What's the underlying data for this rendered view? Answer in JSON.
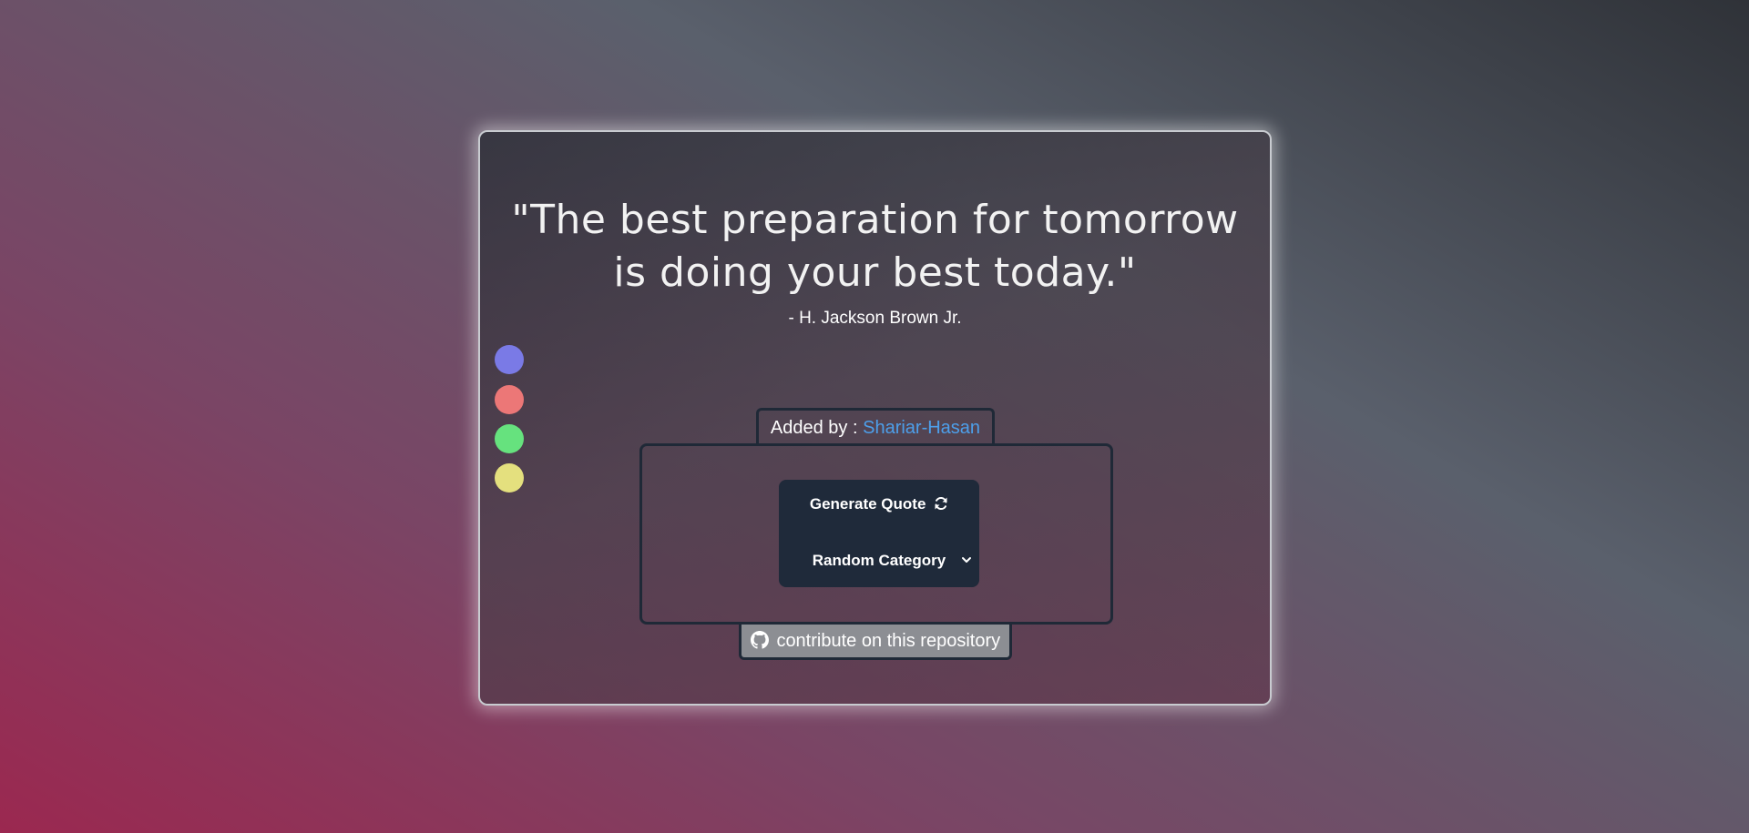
{
  "quote": {
    "text": "\"The best preparation for tomorrow is doing your best today.\"",
    "author": "- H. Jackson Brown Jr."
  },
  "theme_colors": [
    "#7a7ae6",
    "#ec7777",
    "#66e27e",
    "#e4e07e"
  ],
  "added_by": {
    "label": "Added by : ",
    "user": "Shariar-Hasan"
  },
  "controls": {
    "generate_label": "Generate Quote",
    "generate_icon": "refresh-icon",
    "category_selected": "Random Category",
    "category_icon": "chevron-down-icon"
  },
  "footer": {
    "contribute_label": "contribute on this repository",
    "contribute_icon": "github-icon"
  }
}
